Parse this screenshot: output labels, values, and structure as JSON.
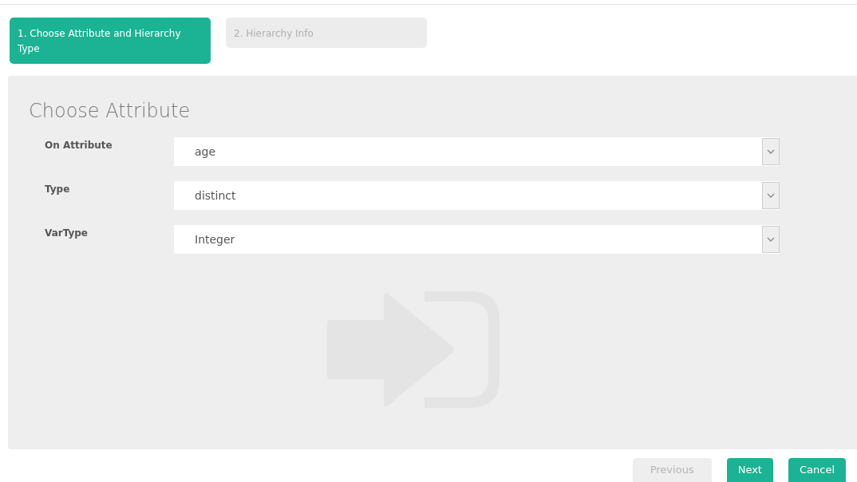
{
  "steps": [
    {
      "label": "1. Choose Attribute and Hierarchy Type",
      "selected": true
    },
    {
      "label": "2. Hierarchy Info",
      "selected": false
    }
  ],
  "panel": {
    "title": "Choose Attribute",
    "fields": [
      {
        "label": "On Attribute",
        "value": "age"
      },
      {
        "label": "Type",
        "value": "distinct"
      },
      {
        "label": "VarType",
        "value": "Integer"
      }
    ]
  },
  "buttons": [
    {
      "label": "Previous",
      "disabled": true
    },
    {
      "label": "Next",
      "disabled": false
    },
    {
      "label": "Cancel",
      "disabled": false
    }
  ]
}
